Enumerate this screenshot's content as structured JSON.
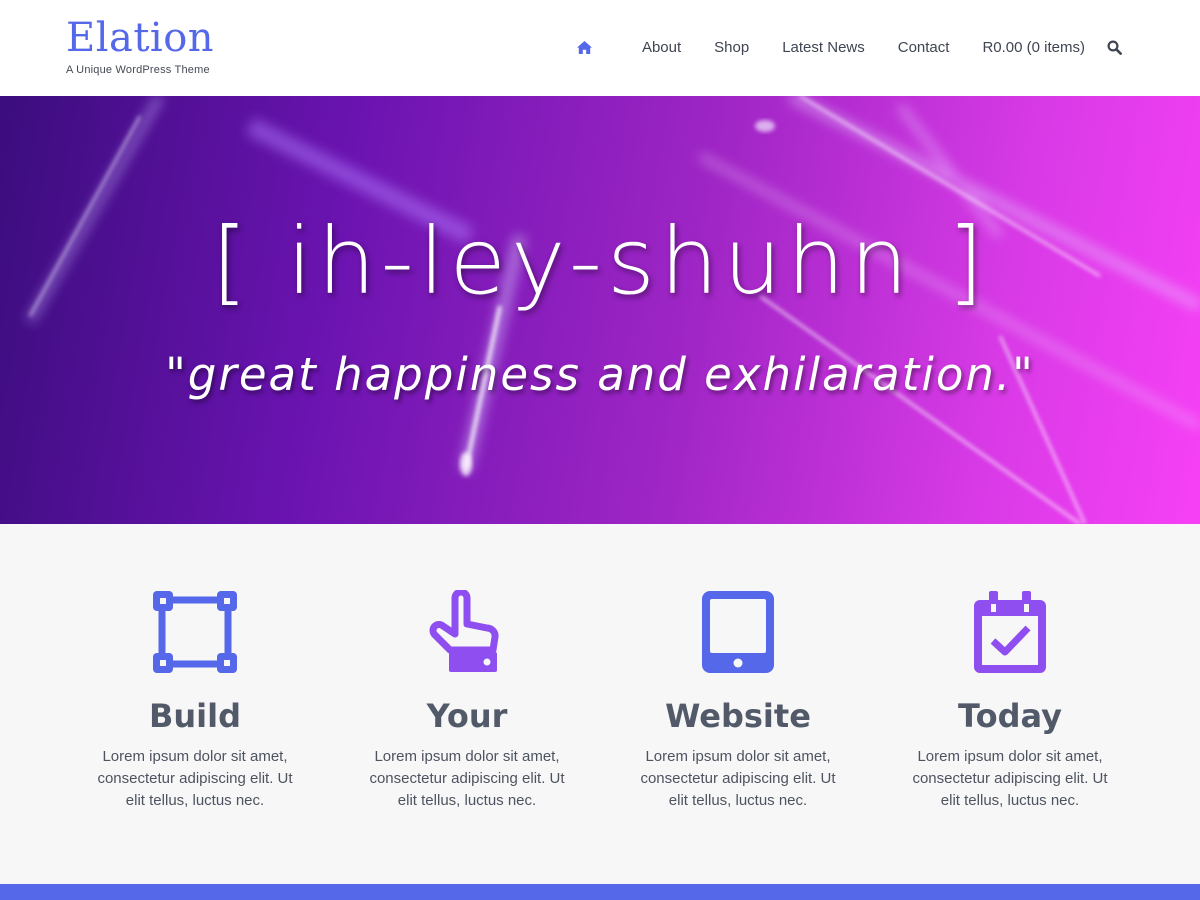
{
  "header": {
    "site_title": "Elation",
    "tagline": "A Unique WordPress Theme",
    "nav": {
      "home_icon": "home-icon",
      "items": [
        "About",
        "Shop",
        "Latest News",
        "Contact",
        "R0.00 (0 items)"
      ],
      "search_icon": "search-icon"
    }
  },
  "hero": {
    "title": "[ ih-ley-shuhn ]",
    "subtitle": "\"great happiness and exhilaration.\""
  },
  "features": [
    {
      "icon": "vector-square-icon",
      "title": "Build",
      "text": "Lorem ipsum dolor sit amet, consectetur adipiscing elit. Ut elit tellus, luctus nec."
    },
    {
      "icon": "hand-pointer-icon",
      "title": "Your",
      "text": "Lorem ipsum dolor sit amet, consectetur adipiscing elit. Ut elit tellus, luctus nec."
    },
    {
      "icon": "tablet-icon",
      "title": "Website",
      "text": "Lorem ipsum dolor sit amet, consectetur adipiscing elit. Ut elit tellus, luctus nec."
    },
    {
      "icon": "calendar-check-icon",
      "title": "Today",
      "text": "Lorem ipsum dolor sit amet, consectetur adipiscing elit. Ut elit tellus, luctus nec."
    }
  ],
  "colors": {
    "brand_blue": "#5468e9",
    "purple_accent": "#8f4ff0",
    "hero_start": "#3b0d7d",
    "hero_end": "#f740f6",
    "heading_gray": "#525a6a"
  }
}
